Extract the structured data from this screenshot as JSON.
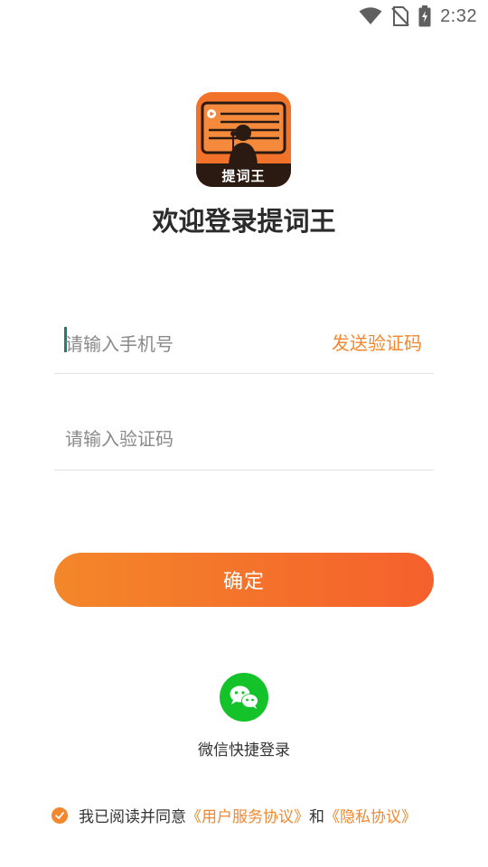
{
  "status_bar": {
    "time": "2:32",
    "icons": [
      "wifi-icon",
      "no-sim-icon",
      "battery-charging-icon"
    ]
  },
  "logo": {
    "text": "提词王",
    "icon": "teleprompter-logo-icon"
  },
  "welcome_title": "欢迎登录提词王",
  "phone_field": {
    "placeholder": "请输入手机号",
    "value": ""
  },
  "send_code_label": "发送验证码",
  "code_field": {
    "placeholder": "请输入验证码",
    "value": ""
  },
  "confirm_label": "确定",
  "wechat": {
    "icon": "wechat-icon",
    "label": "微信快捷登录"
  },
  "agreement": {
    "checked": true,
    "prefix": "我已阅读并同意",
    "user_agreement": "《用户服务协议》",
    "and": "和",
    "privacy_policy": "《隐私协议》"
  },
  "colors": {
    "accent": "#f2872e",
    "button_gradient_start": "#f4872a",
    "button_gradient_end": "#f5602c",
    "wechat_green": "#14c32a",
    "text": "#2b2b2b"
  }
}
